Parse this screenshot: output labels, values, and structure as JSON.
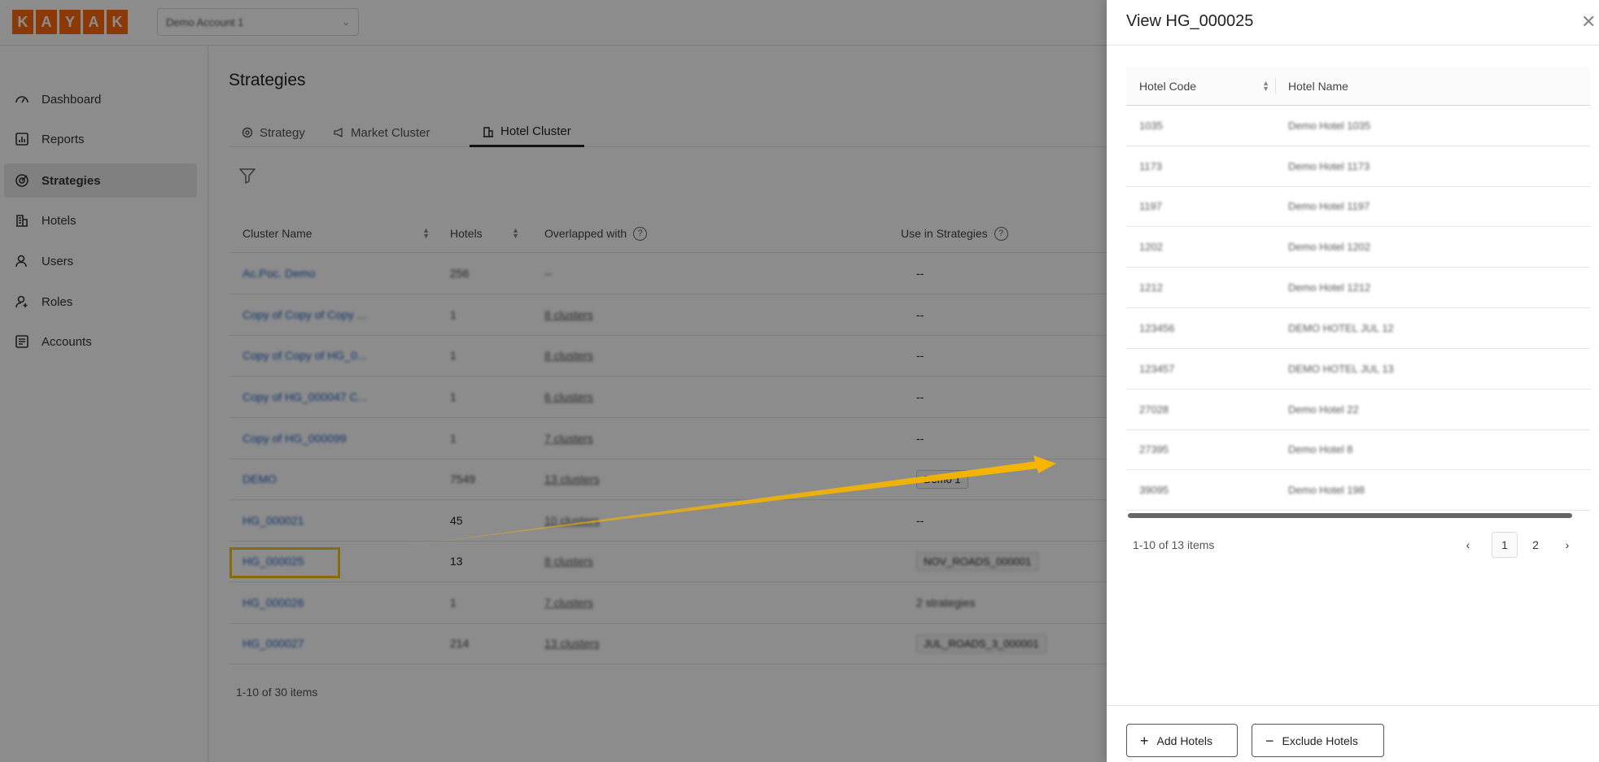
{
  "brand": {
    "logo_letters": [
      "K",
      "A",
      "Y",
      "A",
      "K"
    ],
    "accent": "#ff690f"
  },
  "account_select": {
    "value": "Demo Account 1"
  },
  "sidebar": {
    "items": [
      {
        "label": "Dashboard",
        "icon": "dashboard-icon"
      },
      {
        "label": "Reports",
        "icon": "reports-icon"
      },
      {
        "label": "Strategies",
        "icon": "strategies-icon",
        "active": true
      },
      {
        "label": "Hotels",
        "icon": "hotels-icon"
      },
      {
        "label": "Users",
        "icon": "users-icon"
      },
      {
        "label": "Roles",
        "icon": "roles-icon"
      },
      {
        "label": "Accounts",
        "icon": "accounts-icon"
      }
    ]
  },
  "main": {
    "title": "Strategies",
    "tabs": [
      {
        "label": "Strategy"
      },
      {
        "label": "Market Cluster"
      },
      {
        "label": "Hotel Cluster",
        "active": true
      }
    ],
    "columns": [
      "Cluster Name",
      "Hotels",
      "Overlapped with",
      "Use in Strategies"
    ],
    "rows": [
      {
        "name": "Ac.Poc. Demo",
        "hotels": "256",
        "overlap": "--",
        "use": "--"
      },
      {
        "name": "Copy of Copy of Copy ...",
        "hotels": "1",
        "overlap": "8 clusters",
        "use": "--"
      },
      {
        "name": "Copy of Copy of HG_0...",
        "hotels": "1",
        "overlap": "8 clusters",
        "use": "--"
      },
      {
        "name": "Copy of HG_000047 C...",
        "hotels": "1",
        "overlap": "6 clusters",
        "use": "--"
      },
      {
        "name": "Copy of HG_000099",
        "hotels": "1",
        "overlap": "7 clusters",
        "use": "--"
      },
      {
        "name": "DEMO",
        "hotels": "7549",
        "overlap": "13 clusters",
        "use": "Demo 1"
      },
      {
        "name": "HG_000021",
        "hotels": "45",
        "overlap": "10 clusters",
        "use": "--"
      },
      {
        "name": "HG_000025",
        "hotels": "13",
        "overlap": "8 clusters",
        "use": "NOV_ROADS_000001"
      },
      {
        "name": "HG_000026",
        "hotels": "1",
        "overlap": "7 clusters",
        "use": "2 strategies"
      },
      {
        "name": "HG_000027",
        "hotels": "214",
        "overlap": "13 clusters",
        "use": "JUL_ROADS_3_000001"
      }
    ],
    "count_text": "1-10 of 30 items"
  },
  "drawer": {
    "title": "View HG_000025",
    "columns": [
      "Hotel Code",
      "Hotel Name"
    ],
    "rows": [
      {
        "code": "1035",
        "name": "Demo Hotel 1035"
      },
      {
        "code": "1173",
        "name": "Demo Hotel 1173"
      },
      {
        "code": "1197",
        "name": "Demo Hotel 1197"
      },
      {
        "code": "1202",
        "name": "Demo Hotel 1202"
      },
      {
        "code": "1212",
        "name": "Demo Hotel 1212"
      },
      {
        "code": "123456",
        "name": "DEMO HOTEL JUL 12"
      },
      {
        "code": "123457",
        "name": "DEMO HOTEL JUL 13"
      },
      {
        "code": "27028",
        "name": "Demo Hotel 22"
      },
      {
        "code": "27395",
        "name": "Demo Hotel 8"
      },
      {
        "code": "39095",
        "name": "Demo Hotel 198"
      }
    ],
    "count_text": "1-10 of 13 items",
    "pages": [
      "1",
      "2"
    ],
    "add_label": "Add Hotels",
    "exclude_label": "Exclude Hotels"
  },
  "colors": {
    "link": "#1d5fc4",
    "highlight": "#f5c518",
    "arrow": "#f5b400"
  }
}
